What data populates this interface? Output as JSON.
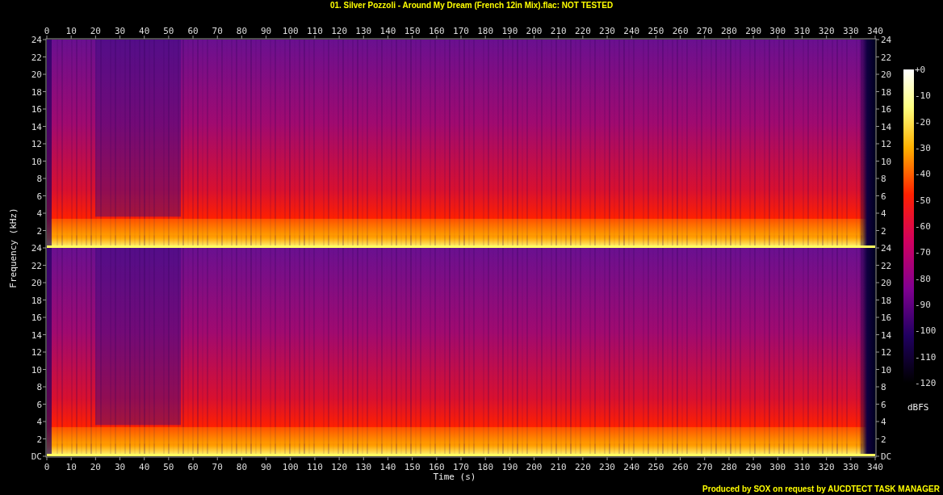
{
  "title": "01. Silver Pozzoli - Around My Dream (French 12in Mix).flac: NOT TESTED",
  "time_axis": {
    "label": "Time (s)",
    "top_ticks": [
      "0",
      "10",
      "20",
      "30",
      "40",
      "50",
      "60",
      "70",
      "80",
      "90",
      "100",
      "110",
      "120",
      "130",
      "140",
      "150",
      "160",
      "170",
      "180",
      "190",
      "200",
      "210",
      "220",
      "230",
      "240",
      "250",
      "260",
      "270",
      "280",
      "290",
      "300",
      "310",
      "320",
      "330",
      "340"
    ],
    "bottom_ticks": [
      "0",
      "10",
      "20",
      "30",
      "40",
      "50",
      "60",
      "70",
      "80",
      "90",
      "100",
      "110",
      "120",
      "130",
      "140",
      "150",
      "160",
      "170",
      "180",
      "190",
      "200",
      "210",
      "220",
      "230",
      "240",
      "250",
      "260",
      "270",
      "280",
      "290",
      "300",
      "310",
      "320",
      "330",
      "340"
    ]
  },
  "frequency_axis": {
    "label": "Frequency (kHz)",
    "left_ticks": [
      "24",
      "22",
      "20",
      "18",
      "16",
      "14",
      "12",
      "10",
      "8",
      "6",
      "4",
      "2",
      "24",
      "22",
      "20",
      "18",
      "16",
      "14",
      "12",
      "10",
      "8",
      "6",
      "4",
      "2",
      "DC"
    ],
    "right_ticks": [
      "24",
      "22",
      "20",
      "18",
      "16",
      "14",
      "12",
      "10",
      "8",
      "6",
      "4",
      "2",
      "24",
      "22",
      "20",
      "18",
      "16",
      "14",
      "12",
      "10",
      "8",
      "6",
      "4",
      "2",
      "DC"
    ]
  },
  "colorbar": {
    "ticks": [
      "+0",
      "-10",
      "-20",
      "-30",
      "-40",
      "-50",
      "-60",
      "-70",
      "-80",
      "-90",
      "-100",
      "-110",
      "-120"
    ],
    "unit": "dBFS"
  },
  "footer": "Produced by SOX on request by AUCDTECT TASK MANAGER"
}
